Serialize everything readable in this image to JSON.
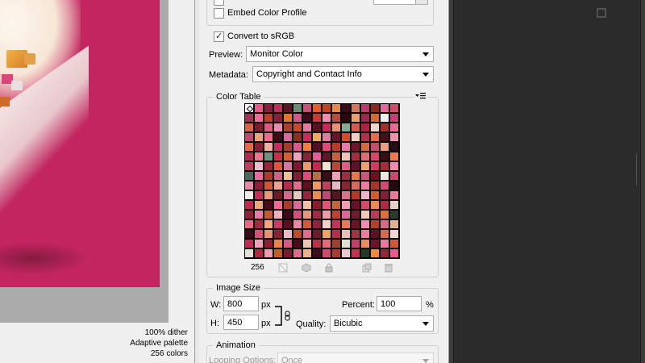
{
  "preview": {
    "info_line1": "100% dither",
    "info_line2": "Adaptive palette",
    "info_line3": "256 colors"
  },
  "settings": {
    "embed_color_profile_label": "Embed Color Profile",
    "embed_color_profile_checked": false,
    "convert_srgb_label": "Convert to sRGB",
    "convert_srgb_checked": true,
    "preview_label": "Preview:",
    "preview_value": "Monitor Color",
    "metadata_label": "Metadata:",
    "metadata_value": "Copyright and Contact Info"
  },
  "color_table": {
    "title": "Color Table",
    "menu_icon": "panel-menu-icon",
    "count": "256",
    "colors": [
      "#ffffff",
      "#e65a8a",
      "#8b1e3a",
      "#b8325c",
      "#5c1424",
      "#6f8a70",
      "#c8507a",
      "#e85a2a",
      "#c0451e",
      "#e8894a",
      "#3a0a14",
      "#d2785a",
      "#b83c6a",
      "#8a2a1e",
      "#e06aa0",
      "#d04a6a",
      "#a03450",
      "#f06a9a",
      "#c03c24",
      "#8a1e3a",
      "#e8742c",
      "#d25a8a",
      "#3c0a18",
      "#c83a3a",
      "#f48ab0",
      "#b84c3c",
      "#2a0810",
      "#e8a070",
      "#9a2848",
      "#d86a30",
      "#f0f0f0",
      "#c83c78",
      "#d8624a",
      "#7a1c2c",
      "#e05a80",
      "#f08ab4",
      "#a8402a",
      "#c84a2a",
      "#e27a9e",
      "#5a1020",
      "#c8285a",
      "#e89070",
      "#8ca88c",
      "#d45a4a",
      "#b02040",
      "#f0d8c8",
      "#a03028",
      "#e86a98",
      "#c04a6a",
      "#e8a47a",
      "#f06a8a",
      "#3a0c1a",
      "#d86a9a",
      "#8a3020",
      "#c82c5c",
      "#f0aa60",
      "#e07aa0",
      "#6a1428",
      "#d04a30",
      "#f3d0c0",
      "#b0304a",
      "#e86a4a",
      "#4a0e1a",
      "#f090b0",
      "#e8684a",
      "#8a1c34",
      "#f0b0a0",
      "#c03060",
      "#a04028",
      "#d85a8a",
      "#f08040",
      "#501020",
      "#e04a7a",
      "#b83a2a",
      "#ec7aa8",
      "#701828",
      "#d26a40",
      "#c0506a",
      "#e8a080",
      "#2a0a12",
      "#b02c4c",
      "#e87a90",
      "#709080",
      "#c4324c",
      "#d86030",
      "#f0a0c0",
      "#8a2432",
      "#e85a9a",
      "#601424",
      "#c8603a",
      "#f0c4b0",
      "#a82c40",
      "#e06a78",
      "#d8446c",
      "#3c0c16",
      "#f07a50",
      "#c03c64",
      "#f0bcd0",
      "#9a2438",
      "#e0563c",
      "#d07aa0",
      "#7a1a30",
      "#e8986a",
      "#c82850",
      "#f4e0d4",
      "#b84830",
      "#e05a88",
      "#601226",
      "#f0a070",
      "#d23a60",
      "#a82c3c",
      "#f08ab0",
      "#4a6a60",
      "#e86aa0",
      "#b03a28",
      "#d06088",
      "#f0c090",
      "#801c34",
      "#e4477a",
      "#c06a48",
      "#3a0a16",
      "#f29cb8",
      "#a02c44",
      "#e8784a",
      "#d05478",
      "#700f22",
      "#f0e8e0",
      "#c84870",
      "#e88aa8",
      "#901e38",
      "#d05a30",
      "#f0a090",
      "#b82a50",
      "#e06a90",
      "#5c1020",
      "#f09a60",
      "#c04060",
      "#e8b8c0",
      "#8a2430",
      "#d86a5a",
      "#f07aa0",
      "#a8342a",
      "#d24a70",
      "#2a0810",
      "#f0f0e8",
      "#c0305a",
      "#e89a7a",
      "#701828",
      "#d86888",
      "#e6c8b8",
      "#9a2440",
      "#f08a50",
      "#c04874",
      "#5a1420",
      "#e0708a",
      "#b83830",
      "#f0b4c8",
      "#d45a2c",
      "#802038",
      "#e87a98",
      "#c02c4c",
      "#e8a87a",
      "#4a0c18",
      "#f06a90",
      "#a83c2a",
      "#d86a9c",
      "#f0c0a8",
      "#8a1c30",
      "#e05478",
      "#c06a3a",
      "#f0a0b0",
      "#6a1226",
      "#d84a6a",
      "#f08850",
      "#b02a44",
      "#e8d0c8",
      "#902238",
      "#e87aa4",
      "#c85a30",
      "#f0b0c0",
      "#3c0a16",
      "#d2507a",
      "#e8987a",
      "#a82848",
      "#f09aa8",
      "#c04030",
      "#e06898",
      "#701a2c",
      "#f0c8b8",
      "#b83c5c",
      "#e0703a",
      "#2c3a30",
      "#e86a8a",
      "#a02c3c",
      "#f0a878",
      "#c83a68",
      "#5a1022",
      "#e88aa0",
      "#d05c30",
      "#8a2440",
      "#f0d0c8",
      "#c03458",
      "#e87a50",
      "#6a1428",
      "#f08cb0",
      "#b04030",
      "#d86888",
      "#e0b090",
      "#3a0a16",
      "#d8507a",
      "#e89070",
      "#902038",
      "#f0b8c8",
      "#c04a2a",
      "#e06a90",
      "#701a30",
      "#f0a060",
      "#b82c50",
      "#e8c0b8",
      "#a03440",
      "#f07aa0",
      "#5c1222",
      "#d86a48",
      "#f0d8d0",
      "#c02c58",
      "#f0a0b8",
      "#8a2030",
      "#e8844a",
      "#d25a88",
      "#4a0c1a",
      "#f0c4b0",
      "#b8304a",
      "#e86a78",
      "#a04028",
      "#e0e0d0",
      "#c0406a",
      "#f08a60",
      "#6a1628",
      "#e87aa0",
      "#d0583a",
      "#e8e0d8",
      "#b02840",
      "#f09ab0",
      "#c85a2c",
      "#7a1a30",
      "#e06a8c",
      "#f0b088",
      "#3c0c18",
      "#d04a70",
      "#a83c30",
      "#f0c8d0",
      "#c03450",
      "#1e3a28",
      "#f08a40",
      "#902a38",
      "#e85a90"
    ]
  },
  "toolbar": {
    "icons": [
      "map-color-icon",
      "web-safe-icon",
      "lock-color-icon",
      "new-color-icon",
      "delete-color-icon"
    ]
  },
  "image_size": {
    "title": "Image Size",
    "w_label": "W:",
    "w_value": "800",
    "w_unit": "px",
    "h_label": "H:",
    "h_value": "450",
    "h_unit": "px",
    "percent_label": "Percent:",
    "percent_value": "100",
    "percent_unit": "%",
    "quality_label": "Quality:",
    "quality_value": "Bicubic"
  },
  "animation": {
    "title": "Animation",
    "looping_label": "Looping Options:",
    "looping_value": "Once"
  }
}
